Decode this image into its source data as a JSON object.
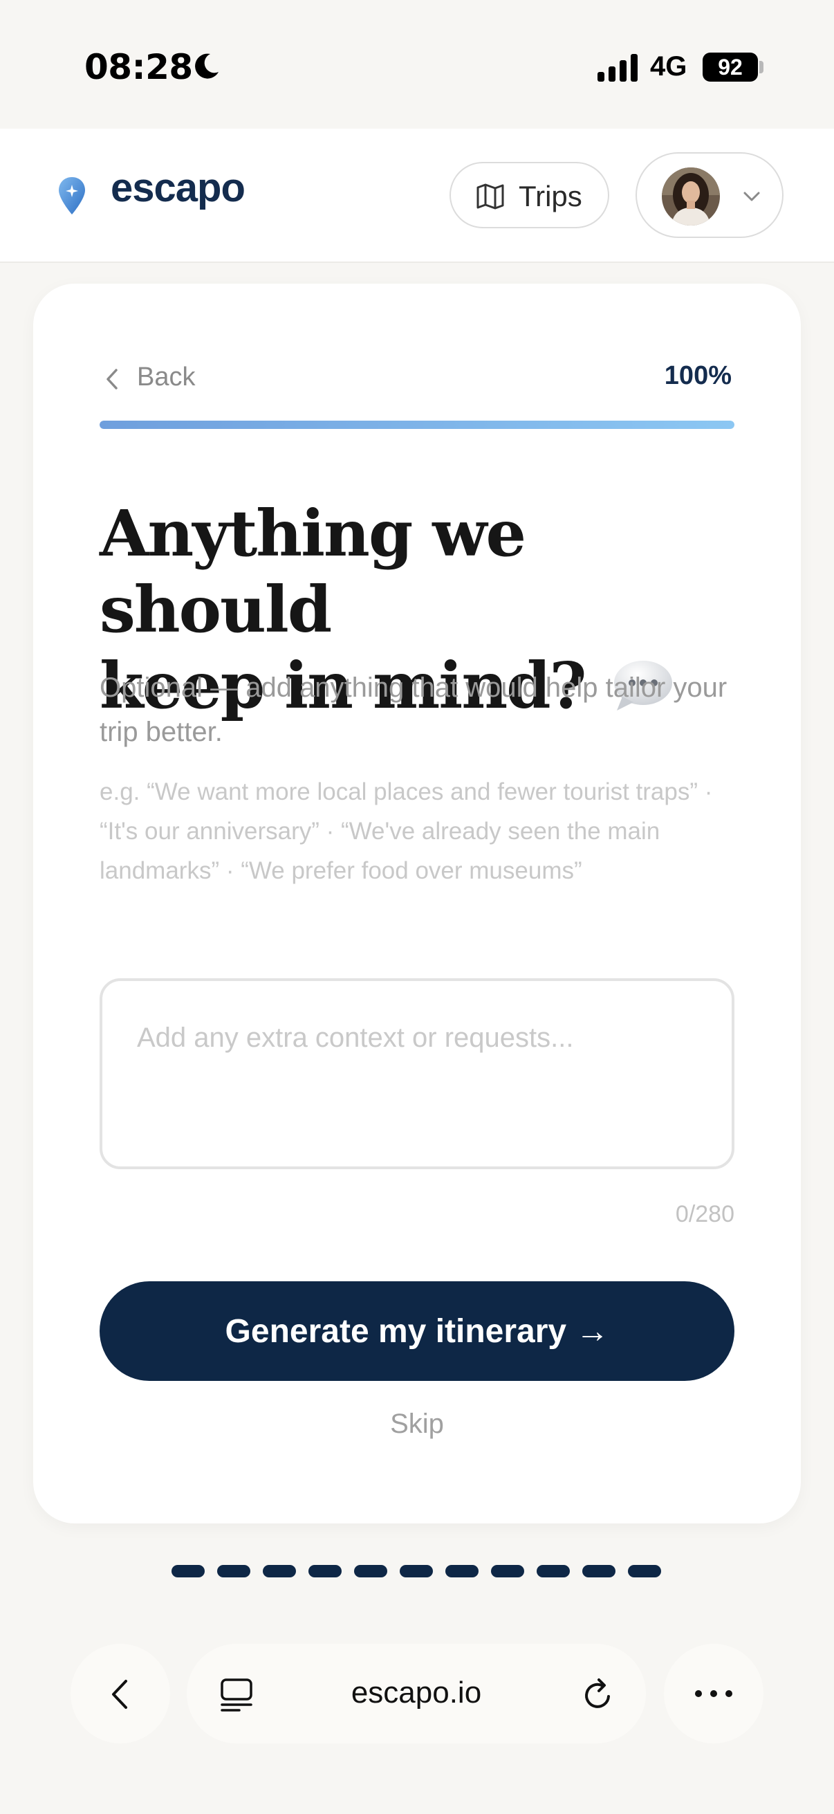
{
  "status_bar": {
    "time": "08:28",
    "network": "4G",
    "battery": "92"
  },
  "header": {
    "logo_text": "escapo",
    "trips_label": "Trips"
  },
  "card": {
    "back_label": "Back",
    "progress_label": "100%",
    "progress_value": 1.0,
    "title_line1": "Anything we should",
    "title_line2": "keep in mind?",
    "subtitle": "Optional — add anything that would help tailor your trip better.",
    "examples": "e.g. “We want more local places and fewer tourist traps” · “It's our anniversary” · “We've already seen the main landmarks” · “We prefer food over museums”",
    "input_placeholder": "Add any extra context or requests...",
    "input_value": "",
    "char_count": "0/280",
    "generate_label": "Generate my itinerary →",
    "skip_label": "Skip"
  },
  "page_dots": {
    "count": 11
  },
  "browser": {
    "url": "escapo.io"
  },
  "colors": {
    "brand_navy": "#0e2746",
    "progress_gradient_start": "#6f9fdd",
    "progress_gradient_end": "#8cc7f3",
    "background": "#f7f6f3"
  },
  "icons": [
    "moon-icon",
    "signal-icon",
    "logo-pin-icon",
    "map-icon",
    "chevron-down-icon",
    "chevron-left-icon",
    "speech-bubble-icon",
    "tabs-icon",
    "reload-icon",
    "more-icon"
  ]
}
